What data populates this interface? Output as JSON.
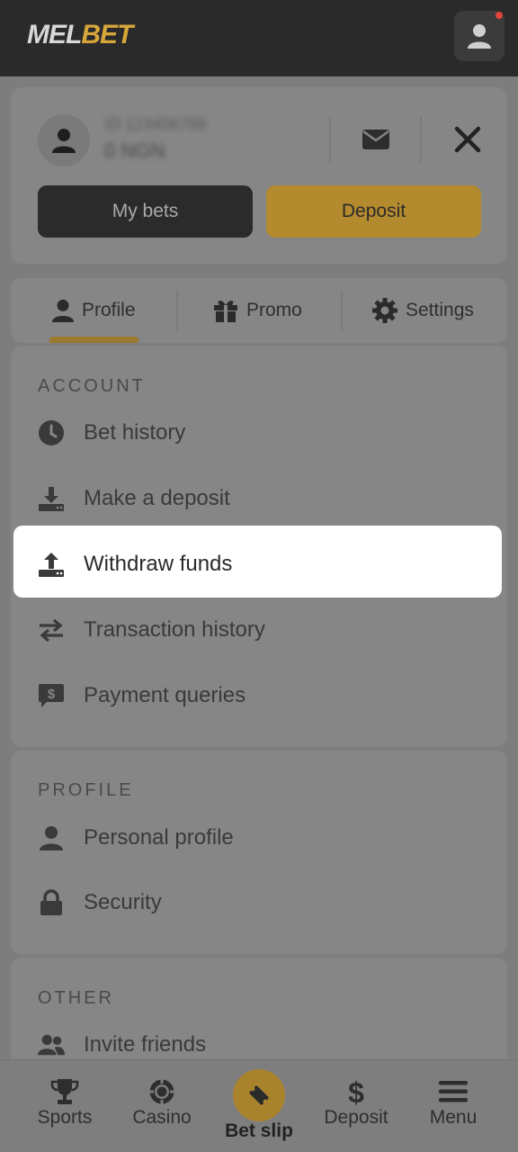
{
  "header": {
    "logo_left": "MEL",
    "logo_right": "BET"
  },
  "user": {
    "id_blurred": "ID 123456789",
    "balance_blurred": "0 NGN"
  },
  "actions": {
    "my_bets": "My bets",
    "deposit": "Deposit"
  },
  "tabs": [
    {
      "label": "Profile",
      "icon": "user-icon",
      "active": true
    },
    {
      "label": "Promo",
      "icon": "gift-icon"
    },
    {
      "label": "Settings",
      "icon": "gear-icon"
    }
  ],
  "sections": {
    "account": {
      "title": "ACCOUNT",
      "items": [
        {
          "label": "Bet history",
          "icon": "clock-icon"
        },
        {
          "label": "Make a deposit",
          "icon": "download-icon"
        },
        {
          "label": "Withdraw funds",
          "icon": "upload-icon",
          "highlighted": true
        },
        {
          "label": "Transaction history",
          "icon": "arrows-icon"
        },
        {
          "label": "Payment queries",
          "icon": "dollar-chat-icon"
        }
      ]
    },
    "profile": {
      "title": "PROFILE",
      "items": [
        {
          "label": "Personal profile",
          "icon": "user-icon"
        },
        {
          "label": "Security",
          "icon": "lock-icon"
        }
      ]
    },
    "other": {
      "title": "OTHER",
      "items": [
        {
          "label": "Invite friends",
          "icon": "users-icon"
        }
      ]
    }
  },
  "bottom_nav": [
    {
      "label": "Sports",
      "icon": "trophy-icon"
    },
    {
      "label": "Casino",
      "icon": "chip-icon"
    },
    {
      "label": "Bet slip",
      "icon": "ticket-icon"
    },
    {
      "label": "Deposit",
      "icon": "dollar-icon"
    },
    {
      "label": "Menu",
      "icon": "hamburger-icon"
    }
  ],
  "colors": {
    "brand_gold": "#d6a63a",
    "topbar": "#2a2a2a",
    "overlay_gray": "#7d7d7d"
  }
}
